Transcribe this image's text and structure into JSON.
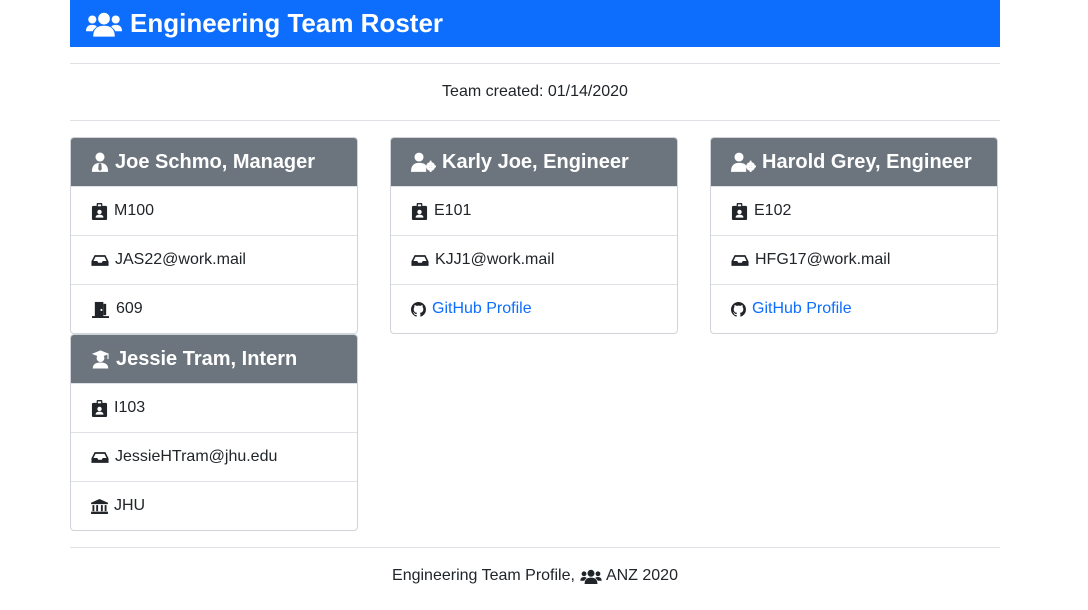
{
  "header": {
    "title": "Engineering Team Roster",
    "icon": "users-icon"
  },
  "team_created": "Team created: 01/14/2020",
  "colors": {
    "header_bg": "#0d6efd",
    "card_header_bg": "#6c757d",
    "link": "#0d6efd"
  },
  "cards": [
    {
      "title": "Joe Schmo, Manager",
      "role_icon": "user-tie-icon",
      "id": "M100",
      "email": "JAS22@work.mail",
      "extra": "609",
      "extra_icon": "door-icon"
    },
    {
      "title": "Karly Joe, Engineer",
      "role_icon": "user-cog-icon",
      "id": "E101",
      "email": "KJJ1@work.mail",
      "extra": "GitHub Profile",
      "extra_icon": "github-icon"
    },
    {
      "title": "Harold Grey, Engineer",
      "role_icon": "user-cog-icon",
      "id": "E102",
      "email": "HFG17@work.mail",
      "extra": "GitHub Profile",
      "extra_icon": "github-icon"
    },
    {
      "title": "Jessie Tram, Intern",
      "role_icon": "graduate-icon",
      "id": "I103",
      "email": "JessieHTram@jhu.edu",
      "extra": "JHU",
      "extra_icon": "university-icon"
    }
  ],
  "footer": {
    "text_before": "Engineering Team Profile,",
    "text_after": "ANZ 2020",
    "icon": "users-icon"
  }
}
